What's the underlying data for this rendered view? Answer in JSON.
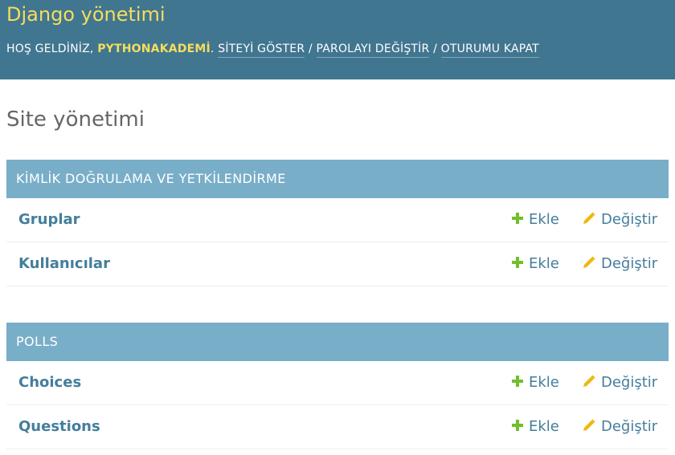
{
  "header": {
    "branding": "Django yönetimi",
    "welcome": "HOŞ GELDİNİZ,",
    "username": "PYTHONAKADEMİ",
    "period": ".",
    "links": {
      "view_site": "SİTEYİ GÖSTER",
      "change_password": "PAROLAYI DEĞİŞTİR",
      "logout": "OTURUMU KAPAT"
    },
    "separator": "/"
  },
  "page_title": "Site yönetimi",
  "modules": [
    {
      "caption": "KİMLİK DOĞRULAMA VE YETKİLENDİRME",
      "models": [
        {
          "name": "Gruplar",
          "add": "Ekle",
          "change": "Değiştir"
        },
        {
          "name": "Kullanıcılar",
          "add": "Ekle",
          "change": "Değiştir"
        }
      ]
    },
    {
      "caption": "POLLS",
      "models": [
        {
          "name": "Choices",
          "add": "Ekle",
          "change": "Değiştir"
        },
        {
          "name": "Questions",
          "add": "Ekle",
          "change": "Değiştir"
        }
      ]
    }
  ],
  "colors": {
    "header_bg": "#417690",
    "branding": "#f5dd5d",
    "caption_bg": "#79aec8",
    "link": "#447e9b",
    "add_icon": "#70bf2b",
    "change_icon": "#efb80b"
  },
  "icons": {
    "add": "plus-icon",
    "change": "pencil-icon"
  }
}
